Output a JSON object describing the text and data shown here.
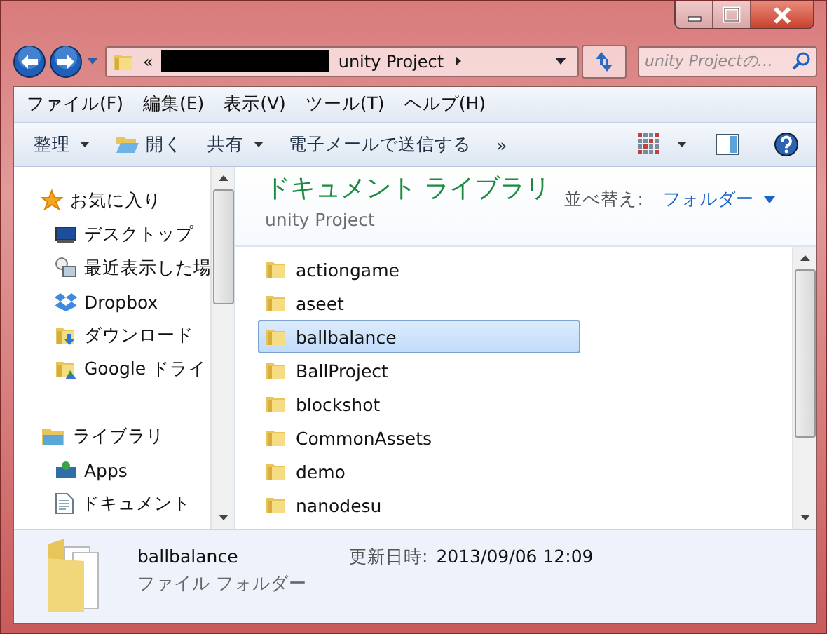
{
  "address": {
    "overflow": "«",
    "path": "unity Project"
  },
  "search": {
    "placeholder": "unity Projectの…"
  },
  "menu": [
    "ファイル(F)",
    "編集(E)",
    "表示(V)",
    "ツール(T)",
    "ヘルプ(H)"
  ],
  "toolbar": [
    {
      "label": "整理",
      "kind": "dropdown"
    },
    {
      "label": "開く",
      "kind": "open"
    },
    {
      "label": "共有",
      "kind": "dropdown"
    },
    {
      "label": "電子メールで送信する",
      "kind": "plain"
    },
    {
      "label": "»",
      "kind": "plain"
    }
  ],
  "sidebar": [
    {
      "label": "お気に入り",
      "kind": "star",
      "children": [
        {
          "label": "デスクトップ",
          "kind": "desktop"
        },
        {
          "label": "最近表示した場",
          "kind": "recent"
        },
        {
          "label": "Dropbox",
          "kind": "dropbox"
        },
        {
          "label": "ダウンロード",
          "kind": "download"
        },
        {
          "label": "Google ドライ",
          "kind": "drive"
        }
      ]
    },
    {
      "label": "ライブラリ",
      "kind": "library",
      "children": [
        {
          "label": "Apps",
          "kind": "apps"
        },
        {
          "label": "ドキュメント",
          "kind": "document"
        }
      ]
    }
  ],
  "library_header": {
    "title": "ドキュメント ライブラリ",
    "subtitle": "unity Project",
    "sort_label": "並べ替え:",
    "sort_value": "フォルダー"
  },
  "files": [
    {
      "name": "actiongame",
      "selected": false
    },
    {
      "name": "aseet",
      "selected": false
    },
    {
      "name": "ballbalance",
      "selected": true
    },
    {
      "name": "BallProject",
      "selected": false
    },
    {
      "name": "blockshot",
      "selected": false
    },
    {
      "name": "CommonAssets",
      "selected": false
    },
    {
      "name": "demo",
      "selected": false
    },
    {
      "name": "nanodesu",
      "selected": false
    }
  ],
  "details": {
    "name": "ballbalance",
    "type": "ファイル フォルダー",
    "modified_label": "更新日時:",
    "modified": "2013/09/06 12:09"
  }
}
